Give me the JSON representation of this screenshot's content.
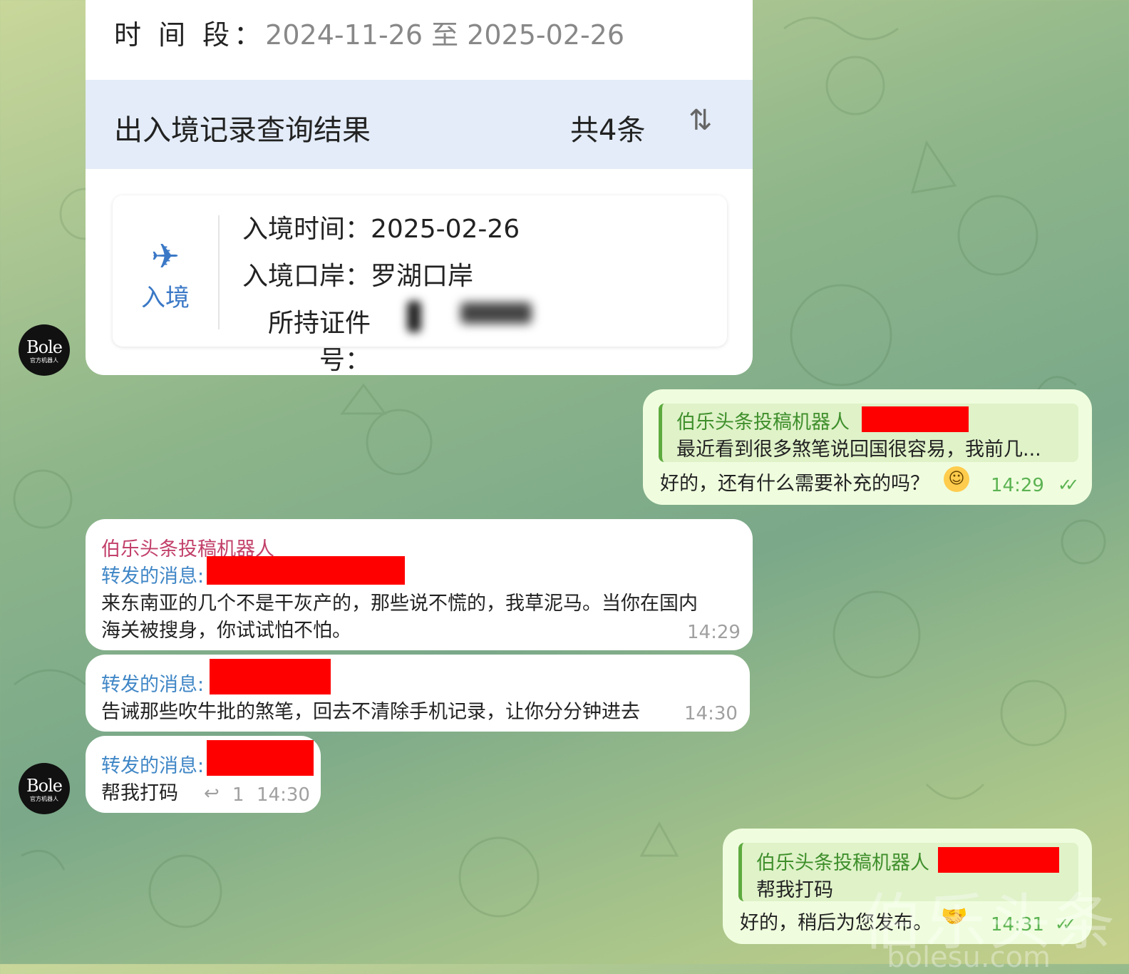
{
  "card": {
    "period_label": "时 间 段：",
    "period_value": "2024-11-26 至 2025-02-26",
    "result_title": "出入境记录查询结果",
    "result_count": "共4条",
    "sort_glyph": "⇅",
    "record": {
      "type": "入境",
      "plane_glyph": "✈",
      "entry_time_label": "入境时间：",
      "entry_time_value": "2025-02-26",
      "port_label": "入境口岸：",
      "port_value": "罗湖口岸",
      "doc_label": "所持证件号："
    }
  },
  "avatar": {
    "logo": "Bole",
    "sub": "官方机器人"
  },
  "messages": [
    {
      "reply_name": "伯乐头条投稿机器人",
      "reply_text": "最近看到很多煞笔说回国很容易，我前几...",
      "text": "好的，还有什么需要补充的吗？",
      "time": "14:29",
      "ticks": "✓✓",
      "emoji": "☺"
    },
    {
      "sender": "伯乐头条投稿机器人",
      "forward_label": "转发的消息:",
      "text_line1": "来东南亚的几个不是干灰产的，那些说不慌的，我草泥马。当你在国内",
      "text_line2": "海关被搜身，你试试怕不怕。",
      "time": "14:29"
    },
    {
      "forward_label": "转发的消息:",
      "text": "告诫那些吹牛批的煞笔，回去不清除手机记录，让你分分钟进去",
      "time": "14:30"
    },
    {
      "forward_label": "转发的消息:",
      "text": "帮我打码",
      "reply_icon": "↩",
      "reply_count": "1",
      "time": "14:30"
    },
    {
      "reply_name": "伯乐头条投稿机器人",
      "reply_text": "帮我打码",
      "text": "好的，稍后为您发布。",
      "emoji": "🤝",
      "time": "14:31",
      "ticks": "✓✓"
    }
  ],
  "watermark": {
    "text": "伯乐头条",
    "url": "bolesu.com"
  }
}
